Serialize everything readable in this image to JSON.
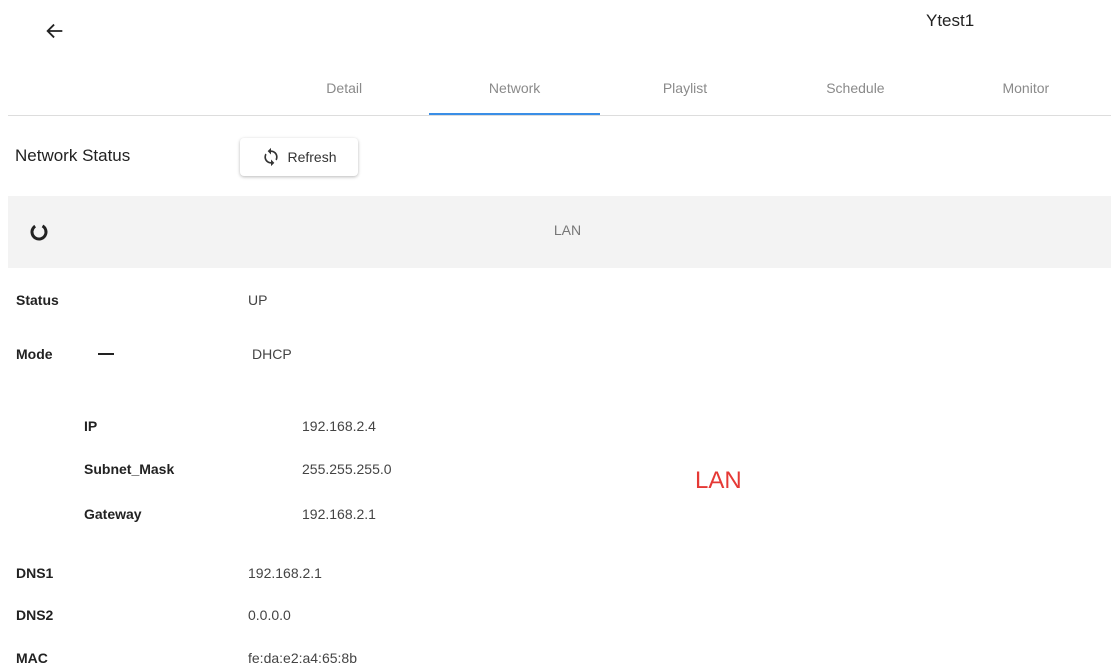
{
  "header": {
    "back_icon": "arrow-left-icon",
    "device_name": "Ytest1"
  },
  "tabs": [
    {
      "label": "Detail",
      "active": false
    },
    {
      "label": "Network",
      "active": true
    },
    {
      "label": "Playlist",
      "active": false
    },
    {
      "label": "Schedule",
      "active": false
    },
    {
      "label": "Monitor",
      "active": false
    }
  ],
  "network_status": {
    "title": "Network Status",
    "refresh_label": "Refresh",
    "refresh_icon": "refresh-icon"
  },
  "lan": {
    "header_label": "LAN",
    "status_icon": "loading-spinner-icon",
    "overlay_label": "LAN",
    "overlay_color": "#e53935",
    "status": {
      "label": "Status",
      "value": "UP"
    },
    "mode": {
      "label": "Mode",
      "value": "DHCP",
      "toggle_icon": "minus-icon"
    },
    "ip": {
      "label": "IP",
      "value": "192.168.2.4"
    },
    "subnet_mask": {
      "label": "Subnet_Mask",
      "value": "255.255.255.0"
    },
    "gateway": {
      "label": "Gateway",
      "value": "192.168.2.1"
    },
    "dns1": {
      "label": "DNS1",
      "value": "192.168.2.1"
    },
    "dns2": {
      "label": "DNS2",
      "value": "0.0.0.0"
    },
    "mac": {
      "label": "MAC",
      "value": "fe:da:e2:a4:65:8b"
    }
  },
  "colors": {
    "accent": "#3a8ee6",
    "header_background": "#f3f3f3"
  }
}
